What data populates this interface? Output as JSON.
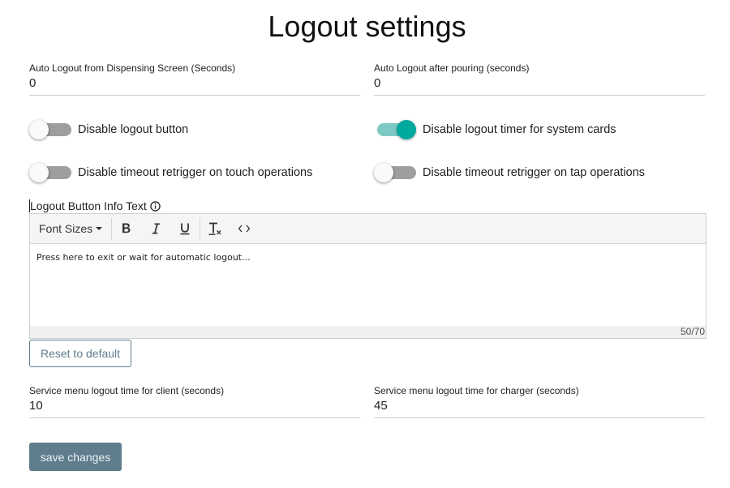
{
  "page": {
    "title": "Logout settings"
  },
  "fields": {
    "auto_logout_dispensing": {
      "label": "Auto Logout from Dispensing Screen (Seconds)",
      "value": "0"
    },
    "auto_logout_pouring": {
      "label": "Auto Logout after pouring (seconds)",
      "value": "0"
    },
    "service_client": {
      "label": "Service menu logout time for client (seconds)",
      "value": "10"
    },
    "service_charger": {
      "label": "Service menu logout time for charger (seconds)",
      "value": "45"
    }
  },
  "toggles": {
    "disable_logout_button": {
      "label": "Disable logout button",
      "on": false
    },
    "disable_logout_timer_system_cards": {
      "label": "Disable logout timer for system cards",
      "on": true
    },
    "disable_retrigger_touch": {
      "label": "Disable timeout retrigger on touch operations",
      "on": false
    },
    "disable_retrigger_tap": {
      "label": "Disable timeout retrigger on tap operations",
      "on": false
    }
  },
  "info_text": {
    "label": "Logout Button Info Text",
    "icon": "info-circle-icon",
    "toolbar": {
      "font_sizes": "Font Sizes",
      "buttons": [
        "bold-icon",
        "italic-icon",
        "underline-icon",
        "clear-format-icon",
        "code-view-icon"
      ]
    },
    "content": "Press here to exit or wait for automatic logout...",
    "counter": "50/70"
  },
  "buttons": {
    "reset": "Reset to default",
    "save": "save changes"
  },
  "colors": {
    "primary": "#5f7d8c",
    "toggle_on": "#00a99d",
    "toggle_on_track": "#7fc9c4",
    "toggle_off_track": "#9e9e9e"
  }
}
